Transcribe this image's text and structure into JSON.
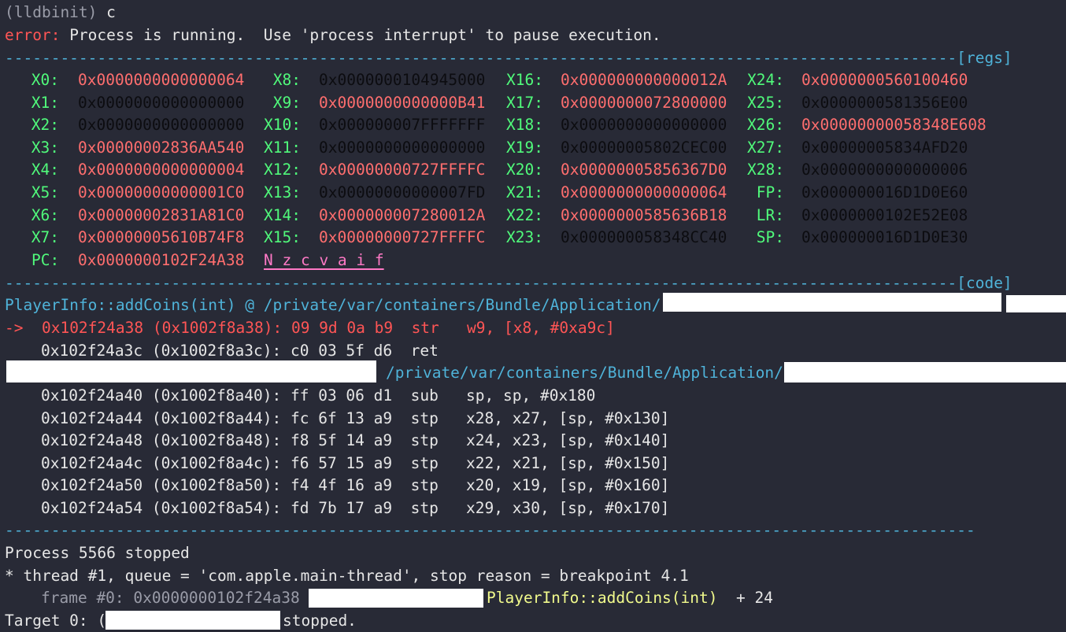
{
  "prompt_line": {
    "prompt": "(lldbinit)",
    "command": " c"
  },
  "error_line": {
    "label": "error:",
    "message": " Process is running.  Use 'process interrupt' to pause execution."
  },
  "separators": {
    "regs_dashes": "-------------------------------------------------------------------------------------------------------",
    "regs_tag": "[regs]",
    "code_dashes": "-------------------------------------------------------------------------------------------------------",
    "code_tag": "[code]",
    "end_dashes": "---------------------------------------------------------------------------------------------------------"
  },
  "registers": [
    [
      {
        "n": "X0:",
        "v": "0x0000000000000064",
        "c": "red"
      },
      {
        "n": "X8:",
        "v": "0x0000000104945000",
        "c": "blk"
      },
      {
        "n": "X16:",
        "v": "0x000000000000012A",
        "c": "red"
      },
      {
        "n": "X24:",
        "v": "0x0000000560100460",
        "c": "red"
      }
    ],
    [
      {
        "n": "X1:",
        "v": "0x0000000000000000",
        "c": "blk"
      },
      {
        "n": "X9:",
        "v": "0x0000000000000B41",
        "c": "red"
      },
      {
        "n": "X17:",
        "v": "0x0000000072800000",
        "c": "red"
      },
      {
        "n": "X25:",
        "v": "0x0000000581356E00",
        "c": "blk"
      }
    ],
    [
      {
        "n": "X2:",
        "v": "0x0000000000000000",
        "c": "blk"
      },
      {
        "n": "X10:",
        "v": "0x000000007FFFFFFF",
        "c": "blk"
      },
      {
        "n": "X18:",
        "v": "0x0000000000000000",
        "c": "blk"
      },
      {
        "n": "X26:",
        "v": "0x00000000058348E608",
        "c": "red"
      }
    ],
    [
      {
        "n": "X3:",
        "v": "0x00000002836AA540",
        "c": "red"
      },
      {
        "n": "X11:",
        "v": "0x0000000000000000",
        "c": "blk"
      },
      {
        "n": "X19:",
        "v": "0x00000005802CEC00",
        "c": "blk"
      },
      {
        "n": "X27:",
        "v": "0x00000005834AFD20",
        "c": "blk"
      }
    ],
    [
      {
        "n": "X4:",
        "v": "0x0000000000000004",
        "c": "red"
      },
      {
        "n": "X12:",
        "v": "0x00000000727FFFFC",
        "c": "red"
      },
      {
        "n": "X20:",
        "v": "0x00000005856367D0",
        "c": "red"
      },
      {
        "n": "X28:",
        "v": "0x0000000000000006",
        "c": "blk"
      }
    ],
    [
      {
        "n": "X5:",
        "v": "0x00000000000001C0",
        "c": "red"
      },
      {
        "n": "X13:",
        "v": "0x00000000000007FD",
        "c": "blk"
      },
      {
        "n": "X21:",
        "v": "0x0000000000000064",
        "c": "red"
      },
      {
        "n": "FP:",
        "v": "0x000000016D1D0E60",
        "c": "blk"
      }
    ],
    [
      {
        "n": "X6:",
        "v": "0x00000002831A81C0",
        "c": "red"
      },
      {
        "n": "X14:",
        "v": "0x000000007280012A",
        "c": "red"
      },
      {
        "n": "X22:",
        "v": "0x0000000585636B18",
        "c": "red"
      },
      {
        "n": "LR:",
        "v": "0x0000000102E52E08",
        "c": "blk"
      }
    ],
    [
      {
        "n": "X7:",
        "v": "0x00000005610B74F8",
        "c": "red"
      },
      {
        "n": "X15:",
        "v": "0x00000000727FFFFC",
        "c": "red"
      },
      {
        "n": "X23:",
        "v": "0x000000058348CC40",
        "c": "blk"
      },
      {
        "n": "SP:",
        "v": "0x000000016D1D0E30",
        "c": "blk"
      }
    ]
  ],
  "pc": {
    "name": "PC:",
    "value": "0x0000000102F24A38",
    "flags": "N z c v a i f"
  },
  "code": {
    "func_header": "PlayerInfo::addCoins(int) @ /private/var/containers/Bundle/Application/",
    "current_marker": "->",
    "current_instr": "0x102f24a38 (0x1002f8a38): 09 9d 0a b9  str   w9, [x8, #0xa9c]",
    "next_instr": "0x102f24a3c (0x1002f8a3c): c0 03 5f d6  ret",
    "second_path": "/private/var/containers/Bundle/Application/",
    "instructions": [
      "0x102f24a40 (0x1002f8a40): ff 03 06 d1  sub   sp, sp, #0x180",
      "0x102f24a44 (0x1002f8a44): fc 6f 13 a9  stp   x28, x27, [sp, #0x130]",
      "0x102f24a48 (0x1002f8a48): f8 5f 14 a9  stp   x24, x23, [sp, #0x140]",
      "0x102f24a4c (0x1002f8a4c): f6 57 15 a9  stp   x22, x21, [sp, #0x150]",
      "0x102f24a50 (0x1002f8a50): f4 4f 16 a9  stp   x20, x19, [sp, #0x160]",
      "0x102f24a54 (0x1002f8a54): fd 7b 17 a9  stp   x29, x30, [sp, #0x170]"
    ]
  },
  "status": {
    "process": "Process 5566 stopped",
    "thread": "* thread #1, queue = 'com.apple.main-thread', stop reason = breakpoint 4.1",
    "frame_prefix": "frame #0: 0x0000000102f24a38",
    "frame_func": "PlayerInfo::addCoins(int)",
    "frame_offset": "  + 24",
    "target_prefix": "Target 0: (",
    "target_suffix": "stopped."
  }
}
